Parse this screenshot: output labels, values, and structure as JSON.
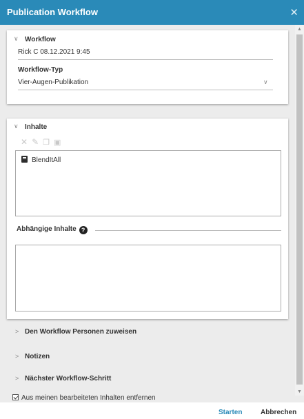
{
  "window": {
    "title": "Publication Workflow"
  },
  "workflow_section": {
    "heading": "Workflow",
    "name_value": "Rick C 08.12.2021 9:45",
    "type_label": "Workflow-Typ",
    "type_value": "Vier-Augen-Publikation"
  },
  "contents_section": {
    "heading": "Inhalte",
    "items": [
      {
        "label": "BlendItAll",
        "icon": "document-icon"
      }
    ],
    "dependent_label": "Abhängige Inhalte",
    "toolbar_icons": [
      "delete-icon",
      "edit-icon",
      "copy-icon",
      "paste-icon"
    ]
  },
  "collapsed_sections": [
    {
      "label": "Den Workflow Personen zuweisen"
    },
    {
      "label": "Notizen"
    },
    {
      "label": "Nächster Workflow-Schritt"
    }
  ],
  "checkbox": {
    "label": "Aus meinen bearbeiteten Inhalten entfernen",
    "checked": true
  },
  "footer": {
    "start_label": "Starten",
    "cancel_label": "Abbrechen"
  },
  "colors": {
    "accent": "#2a8ab8",
    "background": "#ececec"
  }
}
